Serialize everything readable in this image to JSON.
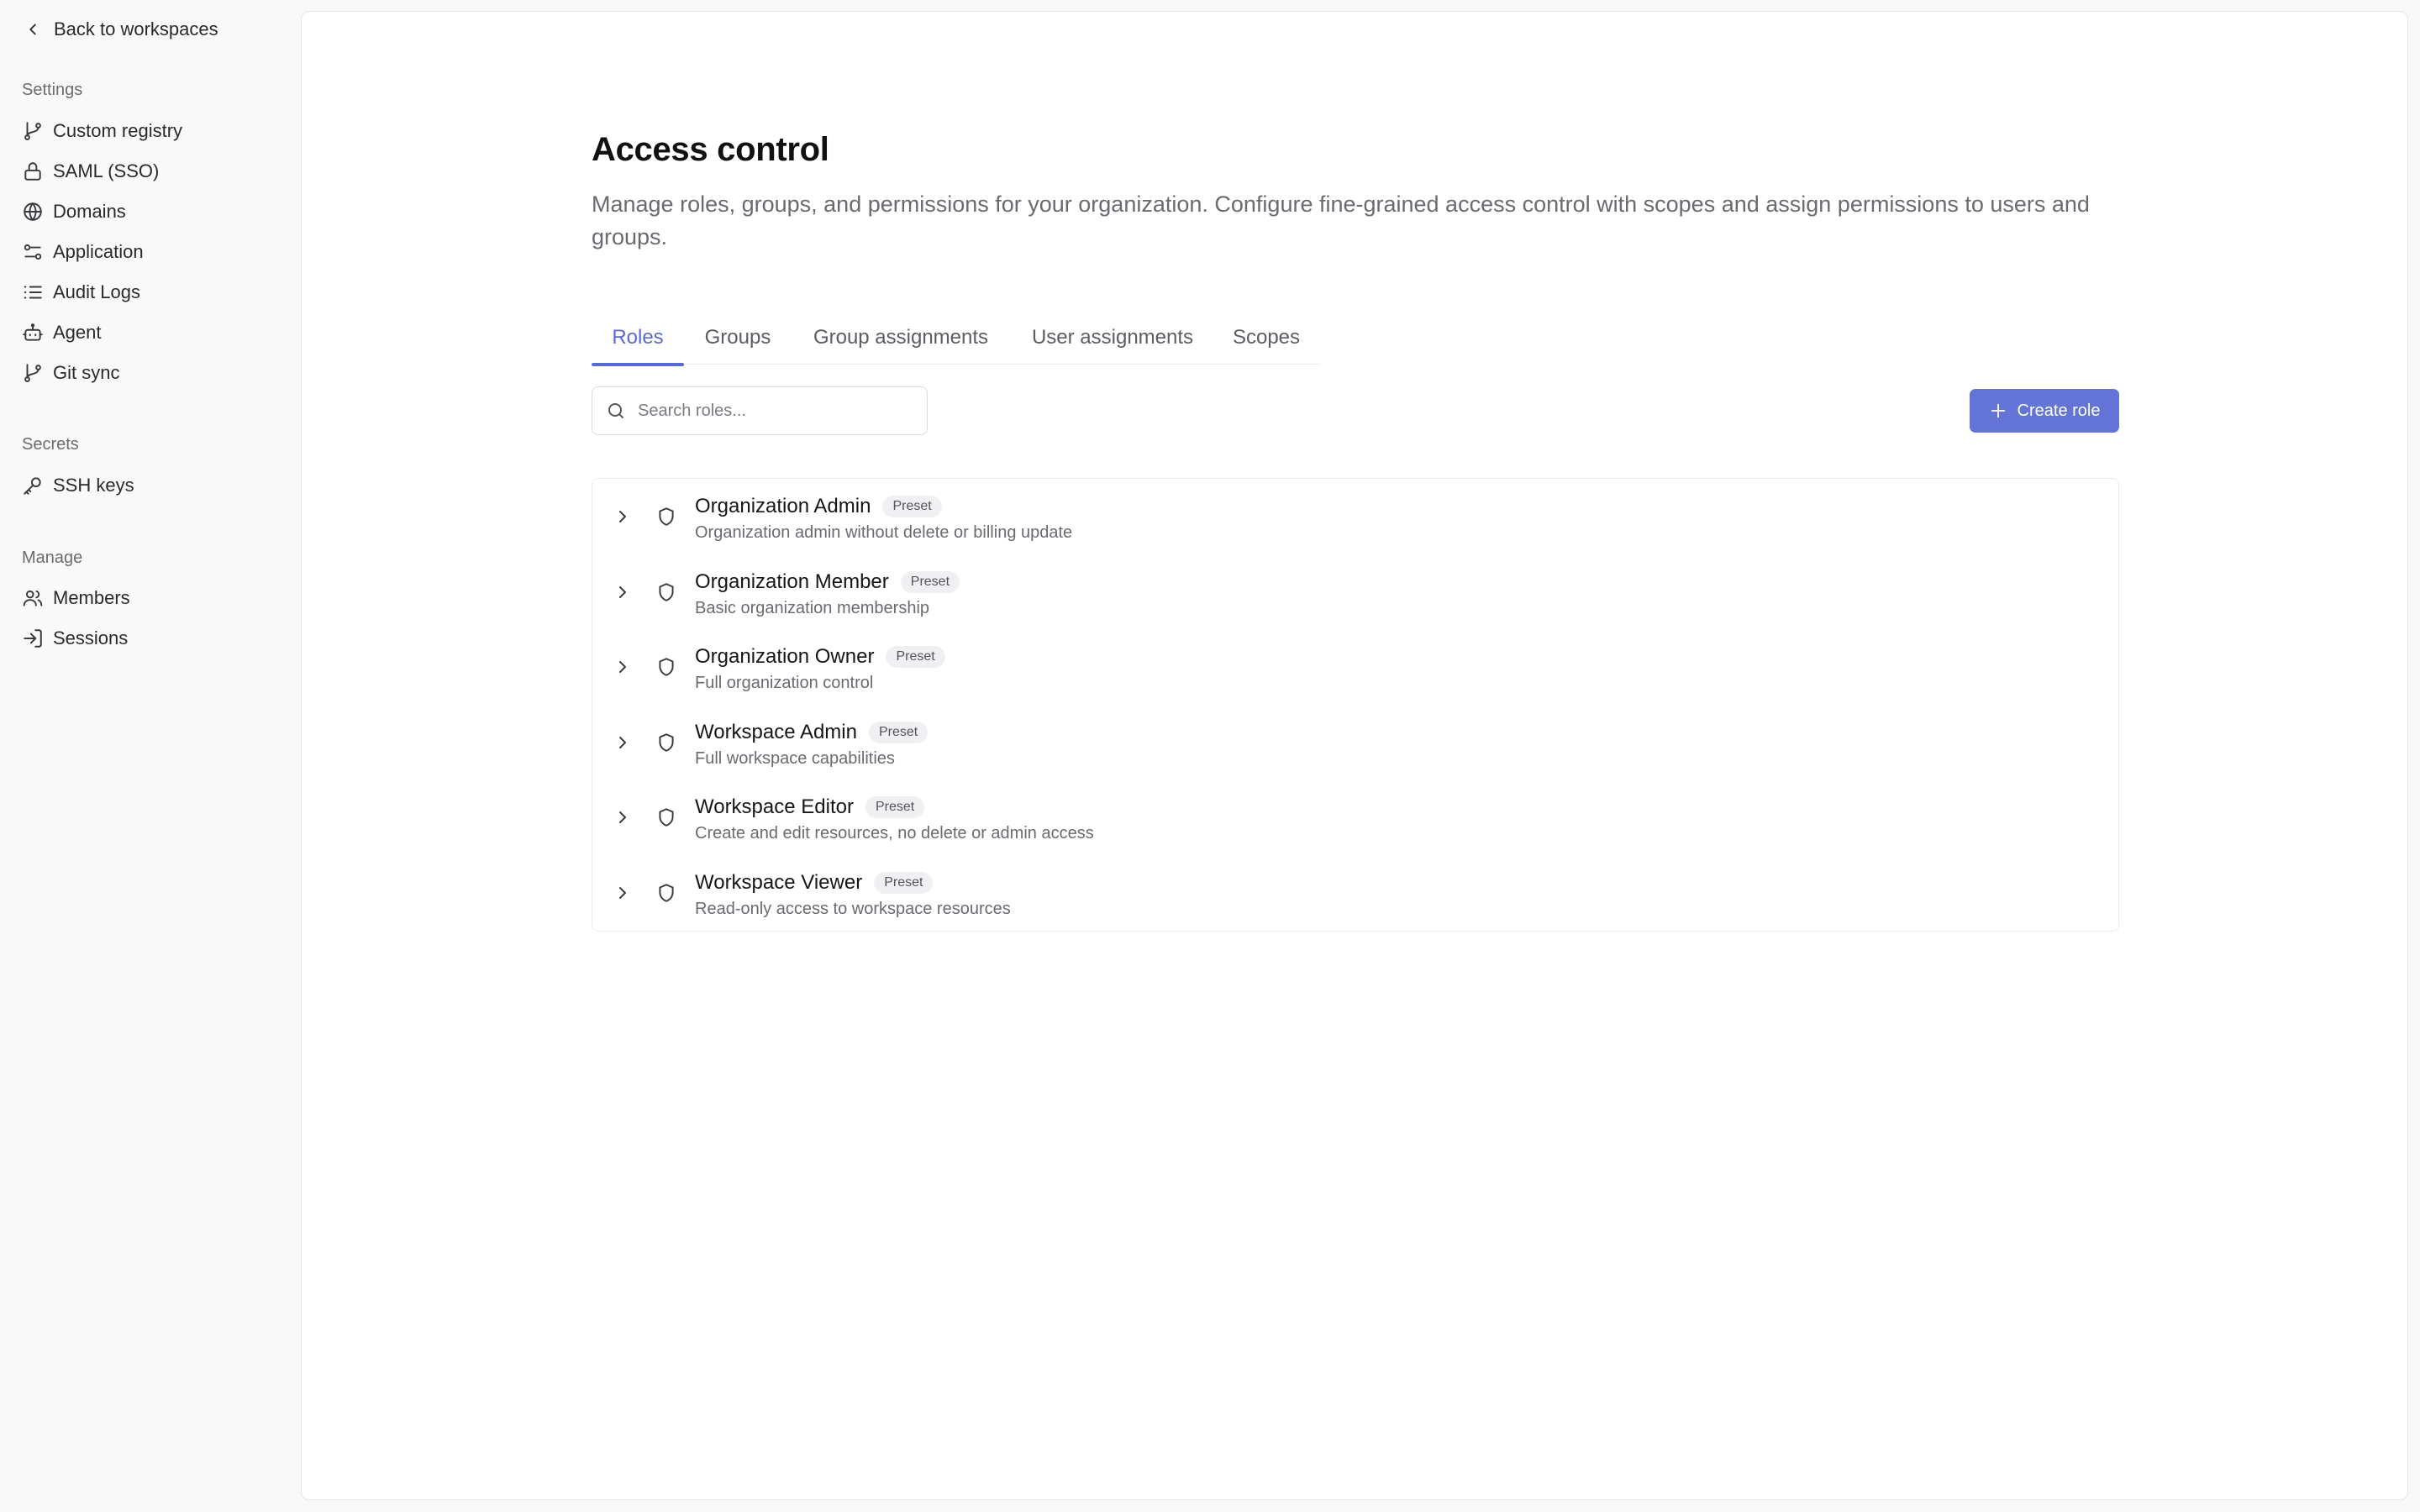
{
  "sidebar": {
    "back_label": "Back to workspaces",
    "sections": [
      {
        "label": "Settings"
      },
      {
        "label": "Secrets"
      },
      {
        "label": "Manage"
      }
    ],
    "items": [
      {
        "label": "Custom registry",
        "icon": "git-branch-icon"
      },
      {
        "label": "SAML (SSO)",
        "icon": "lock-icon"
      },
      {
        "label": "Domains",
        "icon": "globe-icon"
      },
      {
        "label": "Application",
        "icon": "sliders-icon"
      },
      {
        "label": "Audit Logs",
        "icon": "list-icon"
      },
      {
        "label": "Agent",
        "icon": "bot-icon"
      },
      {
        "label": "Git sync",
        "icon": "git-branch-icon"
      },
      {
        "label": "SSH keys",
        "icon": "key-icon"
      },
      {
        "label": "Members",
        "icon": "users-icon"
      },
      {
        "label": "Sessions",
        "icon": "log-in-icon"
      }
    ]
  },
  "main": {
    "title": "Access control",
    "description": "Manage roles, groups, and permissions for your organization. Configure fine-grained access control with scopes and assign permissions to users and groups.",
    "tabs": [
      {
        "label": "Roles",
        "active": true
      },
      {
        "label": "Groups",
        "active": false
      },
      {
        "label": "Group assignments",
        "active": false
      },
      {
        "label": "User assignments",
        "active": false
      },
      {
        "label": "Scopes",
        "active": false
      }
    ],
    "search": {
      "placeholder": "Search roles...",
      "value": ""
    },
    "create_button_label": "Create role",
    "badge_label": "Preset",
    "roles": [
      {
        "name": "Organization Admin",
        "description": "Organization admin without delete or billing update"
      },
      {
        "name": "Organization Member",
        "description": "Basic organization membership"
      },
      {
        "name": "Organization Owner",
        "description": "Full organization control"
      },
      {
        "name": "Workspace Admin",
        "description": "Full workspace capabilities"
      },
      {
        "name": "Workspace Editor",
        "description": "Create and edit resources, no delete or admin access"
      },
      {
        "name": "Workspace Viewer",
        "description": "Read-only access to workspace resources"
      }
    ]
  },
  "colors": {
    "accent": "#5b6ad0",
    "button_bg": "#6474d6",
    "sidebar_bg": "#f9f9f9",
    "panel_bg": "#ffffff"
  }
}
